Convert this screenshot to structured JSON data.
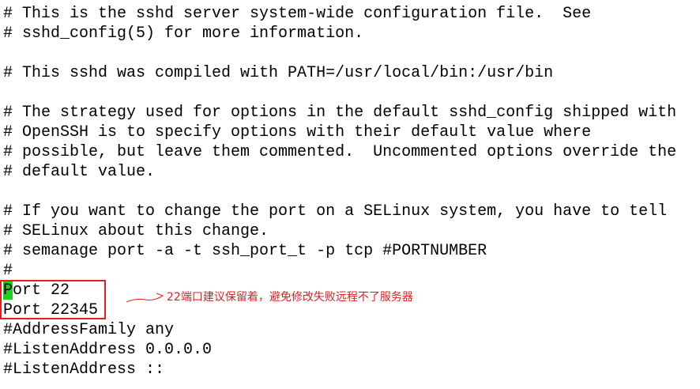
{
  "editor": {
    "lines": [
      "# This is the sshd server system-wide configuration file.  See",
      "# sshd_config(5) for more information.",
      "",
      "# This sshd was compiled with PATH=/usr/local/bin:/usr/bin",
      "",
      "# The strategy used for options in the default sshd_config shipped with",
      "# OpenSSH is to specify options with their default value where",
      "# possible, but leave them commented.  Uncommented options override the",
      "# default value.",
      "",
      "# If you want to change the port on a SELinux system, you have to tell",
      "# SELinux about this change.",
      "# semanage port -a -t ssh_port_t -p tcp #PORTNUMBER",
      "#",
      "Port 22",
      "Port 22345",
      "#AddressFamily any",
      "#ListenAddress 0.0.0.0",
      "#ListenAddress ::"
    ],
    "cursor_char": "P",
    "port22_rest": "ort 22",
    "cursor_color": "#22cc22"
  },
  "annotation": {
    "text": "22端口建议保留着，避免修改失败远程不了服务器",
    "color": "#e02020"
  }
}
